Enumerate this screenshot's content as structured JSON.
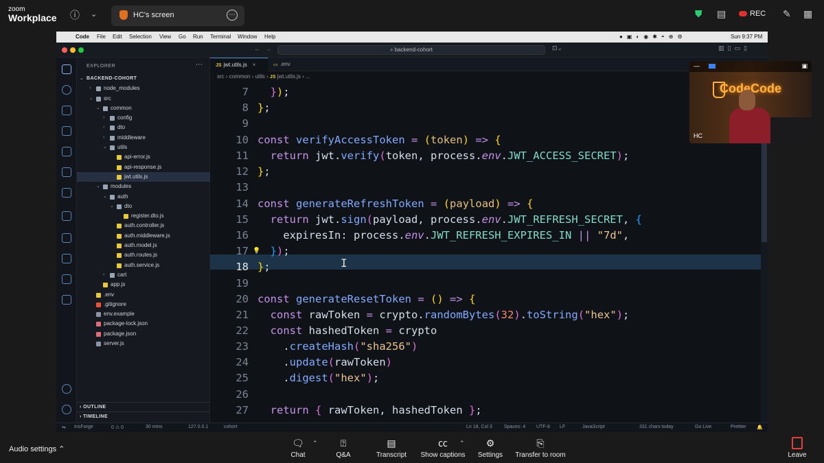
{
  "zoom": {
    "brand_line1": "zoom",
    "brand_line2": "Workplace",
    "share_title": "HC's screen",
    "rec_label": "REC"
  },
  "mac_menu": {
    "app": "Code",
    "items": [
      "File",
      "Edit",
      "Selection",
      "View",
      "Go",
      "Run",
      "Terminal",
      "Window",
      "Help"
    ],
    "clock": "Sun 9:37 PM"
  },
  "vscode": {
    "command_center": "backend-cohort",
    "explorer_title": "EXPLORER",
    "project": "BACKEND-COHORT",
    "tree": [
      {
        "name": "node_modules",
        "depth": 1,
        "type": "folder",
        "open": false
      },
      {
        "name": "src",
        "depth": 1,
        "type": "folder",
        "open": true
      },
      {
        "name": "common",
        "depth": 2,
        "type": "folder",
        "open": true
      },
      {
        "name": "config",
        "depth": 3,
        "type": "folder",
        "open": false
      },
      {
        "name": "dto",
        "depth": 3,
        "type": "folder",
        "open": false
      },
      {
        "name": "middleware",
        "depth": 3,
        "type": "folder",
        "open": false
      },
      {
        "name": "utils",
        "depth": 3,
        "type": "folder",
        "open": true
      },
      {
        "name": "api-error.js",
        "depth": 4,
        "type": "js"
      },
      {
        "name": "api-response.js",
        "depth": 4,
        "type": "js"
      },
      {
        "name": "jwt.utils.js",
        "depth": 4,
        "type": "js",
        "active": true
      },
      {
        "name": "modules",
        "depth": 2,
        "type": "folder",
        "open": true
      },
      {
        "name": "auth",
        "depth": 3,
        "type": "folder",
        "open": true
      },
      {
        "name": "dto",
        "depth": 4,
        "type": "folder",
        "open": true
      },
      {
        "name": "register.dto.js",
        "depth": 5,
        "type": "js"
      },
      {
        "name": "auth.controller.js",
        "depth": 4,
        "type": "js"
      },
      {
        "name": "auth.middleware.js",
        "depth": 4,
        "type": "js"
      },
      {
        "name": "auth.model.js",
        "depth": 4,
        "type": "js"
      },
      {
        "name": "auth.routes.js",
        "depth": 4,
        "type": "js"
      },
      {
        "name": "auth.service.js",
        "depth": 4,
        "type": "js"
      },
      {
        "name": "cart",
        "depth": 3,
        "type": "folder",
        "open": false
      },
      {
        "name": "app.js",
        "depth": 2,
        "type": "js"
      },
      {
        "name": ".env",
        "depth": 1,
        "type": "env"
      },
      {
        "name": ".gitignore",
        "depth": 1,
        "type": "git"
      },
      {
        "name": "env.example",
        "depth": 1,
        "type": "file"
      },
      {
        "name": "package-lock.json",
        "depth": 1,
        "type": "json"
      },
      {
        "name": "package.json",
        "depth": 1,
        "type": "json"
      },
      {
        "name": "server.js",
        "depth": 1,
        "type": "file"
      }
    ],
    "outline_label": "OUTLINE",
    "timeline_label": "TIMELINE",
    "tabs": [
      {
        "label": "jwt.utils.js",
        "active": true
      },
      {
        "label": ".env",
        "active": false
      }
    ],
    "breadcrumb": [
      "src",
      "common",
      "utils",
      "jwt.utils.js",
      "..."
    ],
    "line_numbers": [
      "7",
      "8",
      "9",
      "10",
      "11",
      "12",
      "13",
      "14",
      "15",
      "16",
      "17",
      "18",
      "19",
      "20",
      "21",
      "22",
      "23",
      "24",
      "25",
      "26",
      "27"
    ],
    "current_line": "18",
    "status": {
      "branch": "InsForge",
      "problems": "0 ⚠ 0",
      "timer": "30 mins",
      "host": "127.0.0.1",
      "cohort": "cohort",
      "position": "Ln 18, Col 3",
      "spaces": "Spaces: 4",
      "encoding": "UTF-8",
      "eol": "LF",
      "language": "JavaScript",
      "chars": "331 chars today",
      "golive": "Go Live",
      "prettier": "Prettier"
    }
  },
  "webcam": {
    "label": "HC",
    "sign": "CodeCode"
  },
  "toolbar": {
    "audio_settings": "Audio settings",
    "buttons": [
      "Chat",
      "Q&A",
      "Transcript",
      "Show captions",
      "Settings",
      "Transfer to room"
    ],
    "leave": "Leave"
  }
}
